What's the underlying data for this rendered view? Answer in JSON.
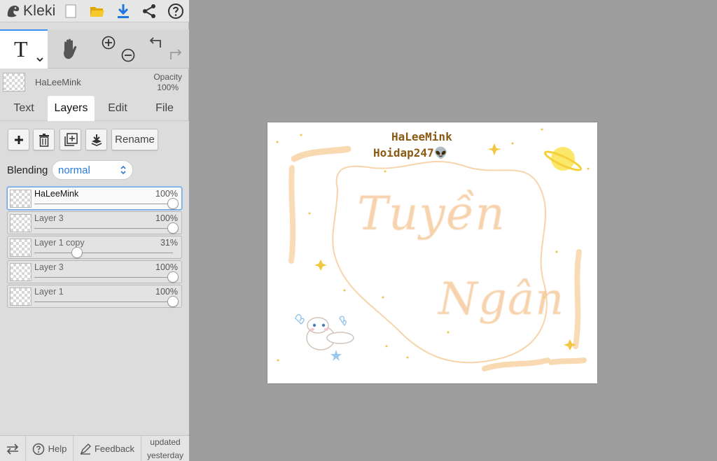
{
  "app": {
    "name": "Kleki"
  },
  "toolbar": {
    "active_tool_glyph": "T"
  },
  "current_layer": {
    "name": "HaLeeMink",
    "opacity_label": "Opacity",
    "opacity_value": "100%"
  },
  "tabs": [
    {
      "label": "Text",
      "active": false
    },
    {
      "label": "Layers",
      "active": true
    },
    {
      "label": "Edit",
      "active": false
    },
    {
      "label": "File",
      "active": false
    }
  ],
  "layer_actions": {
    "rename_label": "Rename"
  },
  "blending": {
    "label": "Blending",
    "value": "normal"
  },
  "layers": [
    {
      "name": "HaLeeMink",
      "opacity": "100%",
      "level": 1.0,
      "active": true
    },
    {
      "name": "Layer 3",
      "opacity": "100%",
      "level": 1.0,
      "active": false
    },
    {
      "name": "Layer 1 copy",
      "opacity": "31%",
      "level": 0.31,
      "active": false
    },
    {
      "name": "Layer 3",
      "opacity": "100%",
      "level": 1.0,
      "active": false
    },
    {
      "name": "Layer 1",
      "opacity": "100%",
      "level": 1.0,
      "active": false
    }
  ],
  "bottom": {
    "help": "Help",
    "feedback": "Feedback",
    "updated_line1": "updated",
    "updated_line2": "yesterday"
  },
  "canvas": {
    "line1": "HaLeeMink",
    "line2": "Hoidap247👽",
    "word1": "Tuyền",
    "word2": "Ngân"
  },
  "colors": {
    "accent": "#3d8ff1",
    "blend_value": "#2a7bd8",
    "panel_bg": "#dcdcdc",
    "workspace_bg": "#9e9e9e",
    "art_peach": "#f4c492"
  },
  "icons": [
    "kleki-logo-icon",
    "new-file-icon",
    "open-folder-icon",
    "download-icon",
    "share-icon",
    "help-circle-icon",
    "hand-icon",
    "zoom-in-icon",
    "zoom-out-icon",
    "undo-icon",
    "redo-icon",
    "plus-icon",
    "trash-icon",
    "duplicate-icon",
    "merge-down-icon",
    "swap-icon",
    "feedback-icon"
  ]
}
